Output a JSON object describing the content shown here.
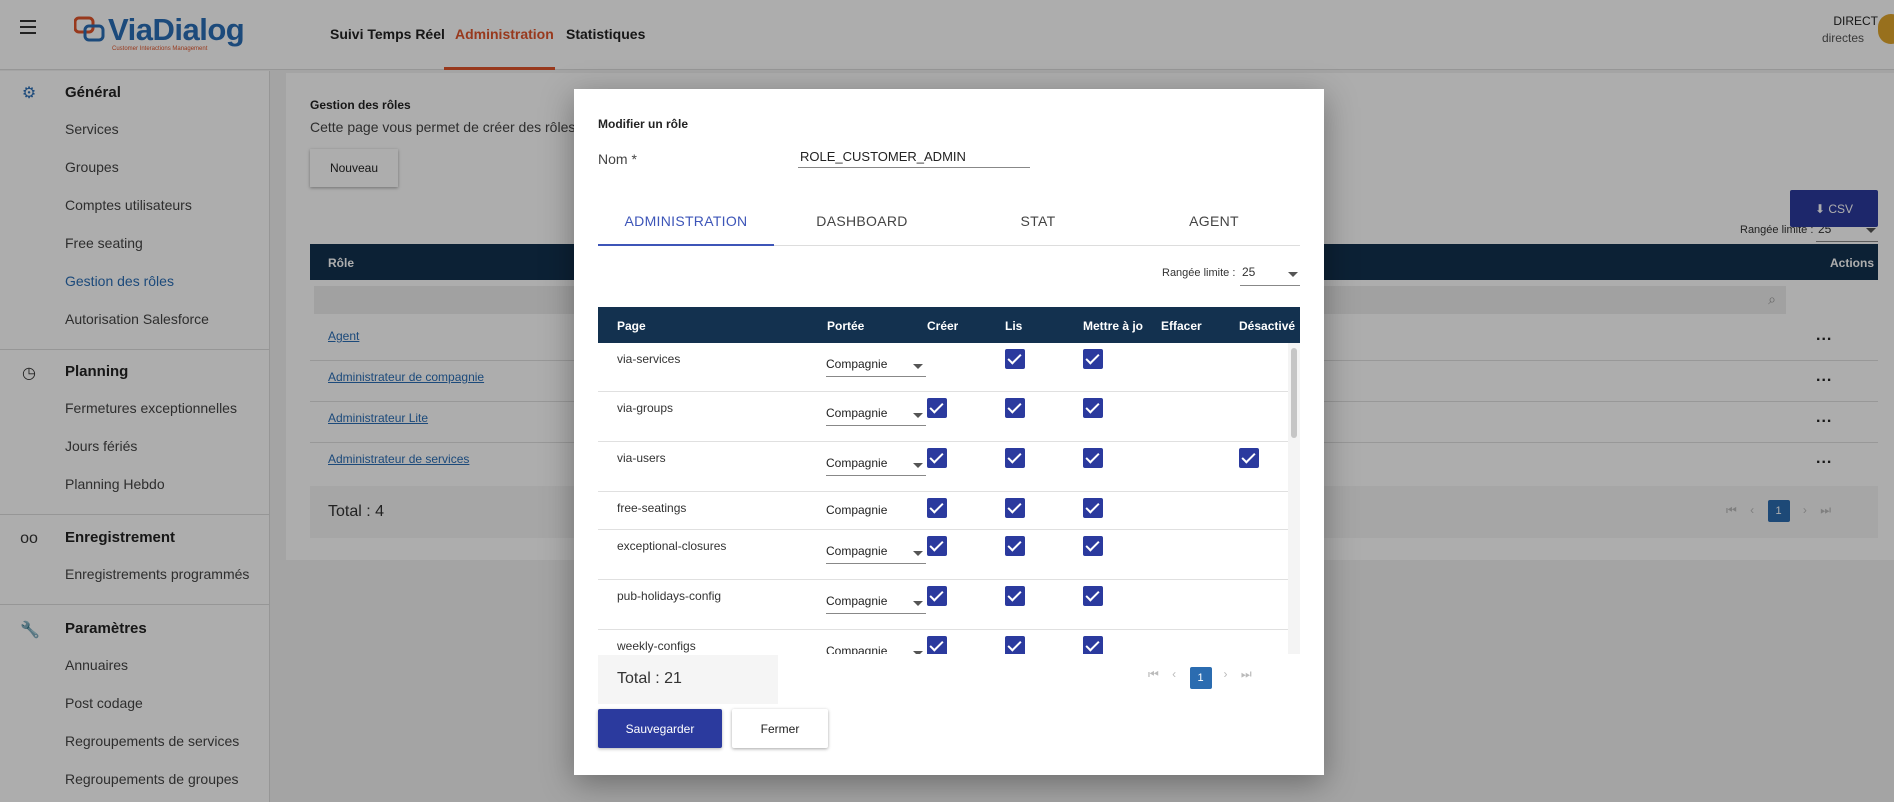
{
  "header": {
    "brand": "ViaDialog",
    "brand_tagline": "Customer Interactions Management",
    "nav": [
      "Suivi Temps Réel",
      "Administration",
      "Statistiques"
    ],
    "user_name": "DIRECT",
    "user_sub": "directes"
  },
  "sidebar": {
    "sections": [
      {
        "title": "Général",
        "icon": "gear-icon",
        "items": [
          "Services",
          "Groupes",
          "Comptes utilisateurs",
          "Free seating",
          "Gestion des rôles",
          "Autorisation Salesforce"
        ]
      },
      {
        "title": "Planning",
        "icon": "clock-icon",
        "items": [
          "Fermetures exceptionnelles",
          "Jours fériés",
          "Planning Hebdo"
        ]
      },
      {
        "title": "Enregistrement",
        "icon": "voicemail-icon",
        "items": [
          "Enregistrements programmés"
        ]
      },
      {
        "title": "Paramètres",
        "icon": "wrench-icon",
        "items": [
          "Annuaires",
          "Post codage",
          "Regroupements de services",
          "Regroupements de groupes"
        ]
      }
    ]
  },
  "main": {
    "title": "Gestion des rôles",
    "description": "Cette page vous permet de créer des rôles",
    "new_button": "Nouveau",
    "limit_label": "Rangée limite :",
    "limit_value": "25",
    "csv_button": "CSV",
    "col_role": "Rôle",
    "col_actions": "Actions",
    "rows": [
      "Agent",
      "Administrateur de compagnie",
      "Administrateur Lite",
      "Administrateur de services"
    ],
    "row_actions": "...",
    "total": "Total : 4",
    "page": "1"
  },
  "modal": {
    "title": "Modifier un rôle",
    "name_label": "Nom *",
    "name_value": "ROLE_CUSTOMER_ADMIN",
    "tabs": [
      "ADMINISTRATION",
      "DASHBOARD",
      "STAT",
      "AGENT"
    ],
    "limit_label": "Rangée limite :",
    "limit_value": "25",
    "columns": [
      "Page",
      "Portée",
      "Créer",
      "Lis",
      "Mettre à jo",
      "Effacer",
      "Désactivé"
    ],
    "rows": [
      {
        "page": "via-services",
        "scope": "Compagnie",
        "select": true,
        "create": false,
        "read": true,
        "update": true,
        "delete": false,
        "disable": false
      },
      {
        "page": "via-groups",
        "scope": "Compagnie",
        "select": true,
        "create": true,
        "read": true,
        "update": true,
        "delete": false,
        "disable": false
      },
      {
        "page": "via-users",
        "scope": "Compagnie",
        "select": true,
        "create": true,
        "read": true,
        "update": true,
        "delete": false,
        "disable": true
      },
      {
        "page": "free-seatings",
        "scope": "Compagnie",
        "select": false,
        "create": true,
        "read": true,
        "update": true,
        "delete": false,
        "disable": false
      },
      {
        "page": "exceptional-closures",
        "scope": "Compagnie",
        "select": true,
        "create": true,
        "read": true,
        "update": true,
        "delete": false,
        "disable": false
      },
      {
        "page": "pub-holidays-config",
        "scope": "Compagnie",
        "select": true,
        "create": true,
        "read": true,
        "update": true,
        "delete": false,
        "disable": false
      },
      {
        "page": "weekly-configs",
        "scope": "Compagnie",
        "select": true,
        "create": true,
        "read": true,
        "update": true,
        "delete": false,
        "disable": false
      }
    ],
    "total": "Total : 21",
    "page": "1",
    "save_button": "Sauvegarder",
    "close_button": "Fermer"
  },
  "colors": {
    "accent": "#e0552b",
    "primary": "#2b3a9e",
    "header_bg": "#13314f",
    "link": "#2a6db5"
  }
}
